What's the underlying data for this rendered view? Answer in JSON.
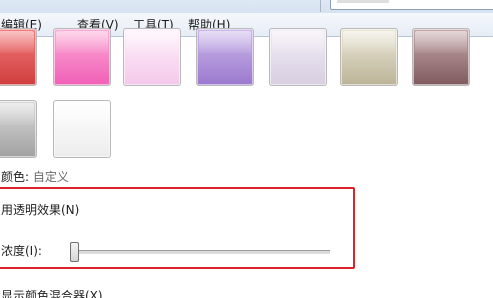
{
  "menu": {
    "edit": "编辑(E)",
    "view": "查看(V)",
    "tools": "工具(T)",
    "help": "帮助(H)"
  },
  "swatches": [
    {
      "name": "red",
      "top": "#f47c7c",
      "bottom": "#cf3d3d"
    },
    {
      "name": "pink",
      "top": "#fcaad6",
      "bottom": "#f060b6"
    },
    {
      "name": "light-pink",
      "top": "#fff0fb",
      "bottom": "#f4c9ea"
    },
    {
      "name": "purple",
      "top": "#ccb8ea",
      "bottom": "#9b79cf"
    },
    {
      "name": "lavender",
      "top": "#f1ecf5",
      "bottom": "#d8cfe1"
    },
    {
      "name": "beige",
      "top": "#ebe7d7",
      "bottom": "#bcb498"
    },
    {
      "name": "mauve",
      "top": "#c7a9ab",
      "bottom": "#7f5a5f"
    },
    {
      "name": "gray",
      "top": "#dadada",
      "bottom": "#a2a2a2"
    },
    {
      "name": "white",
      "top": "#ffffff",
      "bottom": "#ececec"
    }
  ],
  "color_label": {
    "prefix": "颜色:",
    "value": "自定义"
  },
  "transparency_label": "用透明效果(N)",
  "intensity_label": "浓度(I):",
  "intensity_value": 0,
  "mixer_label": "显示颜色混合器(X)",
  "colors": {
    "highlight": "#dd2229",
    "menubar_bg": "#eef3f9"
  }
}
